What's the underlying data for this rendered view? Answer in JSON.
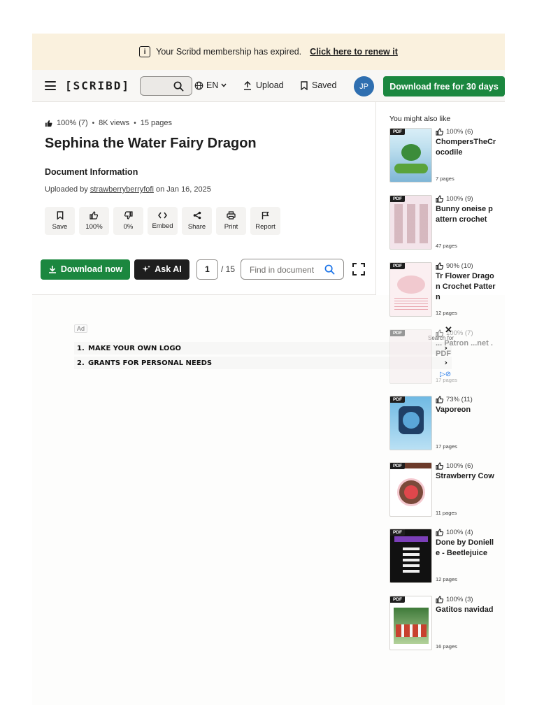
{
  "banner": {
    "message": "Your Scribd membership has expired.",
    "link": "Click here to renew it"
  },
  "nav": {
    "logo": "[SCRIBD]",
    "language": "EN",
    "upload": "Upload",
    "saved": "Saved",
    "avatar_initials": "JP",
    "download_free": "Download free for 30 days"
  },
  "doc": {
    "rating": "100% (7)",
    "views": "8K views",
    "pages": "15 pages",
    "title": "Sephina the Water Fairy Dragon",
    "info_heading": "Document Information",
    "uploaded_prefix": "Uploaded by",
    "uploader": "strawberryberryfofi",
    "uploaded_suffix": "on Jan 16, 2025",
    "actions": [
      {
        "label": "Save",
        "icon": "bookmark-icon"
      },
      {
        "label": "100%",
        "icon": "thumbs-up-icon"
      },
      {
        "label": "0%",
        "icon": "thumbs-down-icon"
      },
      {
        "label": "Embed",
        "icon": "code-icon"
      },
      {
        "label": "Share",
        "icon": "share-icon"
      },
      {
        "label": "Print",
        "icon": "printer-icon"
      },
      {
        "label": "Report",
        "icon": "flag-icon"
      }
    ],
    "download_now": "Download now",
    "ask_ai": "Ask AI",
    "current_page": "1",
    "page_total": "/ 15",
    "find_placeholder": "Find in document"
  },
  "ad": {
    "label": "Ad",
    "search_for": "Search for",
    "items": [
      {
        "num": "1.",
        "text": "MAKE YOUR OWN LOGO"
      },
      {
        "num": "2.",
        "text": "GRANTS FOR PERSONAL NEEDS"
      }
    ]
  },
  "sidebar": {
    "title": "You might also like",
    "pdf_tag": "PDF",
    "cards": [
      {
        "rating": "100% (6)",
        "title": "ChompersTheCrocodile",
        "pages": "7 pages",
        "thumb_color": "#7fb6d6"
      },
      {
        "rating": "100% (9)",
        "title": "Bunny oneise pattern crochet",
        "pages": "47 pages",
        "thumb_color": "#f3e4ea"
      },
      {
        "rating": "90% (10)",
        "title": "Tr Flower Dragon Crochet Pattern",
        "pages": "12 pages",
        "thumb_color": "#fbeff1"
      },
      {
        "rating": "100% (7)",
        "title": "... Patron ...net .PDF",
        "pages": "17 pages",
        "thumb_color": "#f4e7e9"
      },
      {
        "rating": "73% (11)",
        "title": "Vaporeon",
        "pages": "17 pages",
        "thumb_color": "#8ec8ea"
      },
      {
        "rating": "100% (6)",
        "title": "Strawberry Cow",
        "pages": "11 pages",
        "thumb_color": "#fbeaea"
      },
      {
        "rating": "100% (4)",
        "title": "Done by Donielle - Beetlejuice",
        "pages": "12 pages",
        "thumb_color": "#111111"
      },
      {
        "rating": "100% (3)",
        "title": "Gatitos navidad",
        "pages": "16 pages",
        "thumb_color": "#cfe3c7"
      }
    ]
  }
}
